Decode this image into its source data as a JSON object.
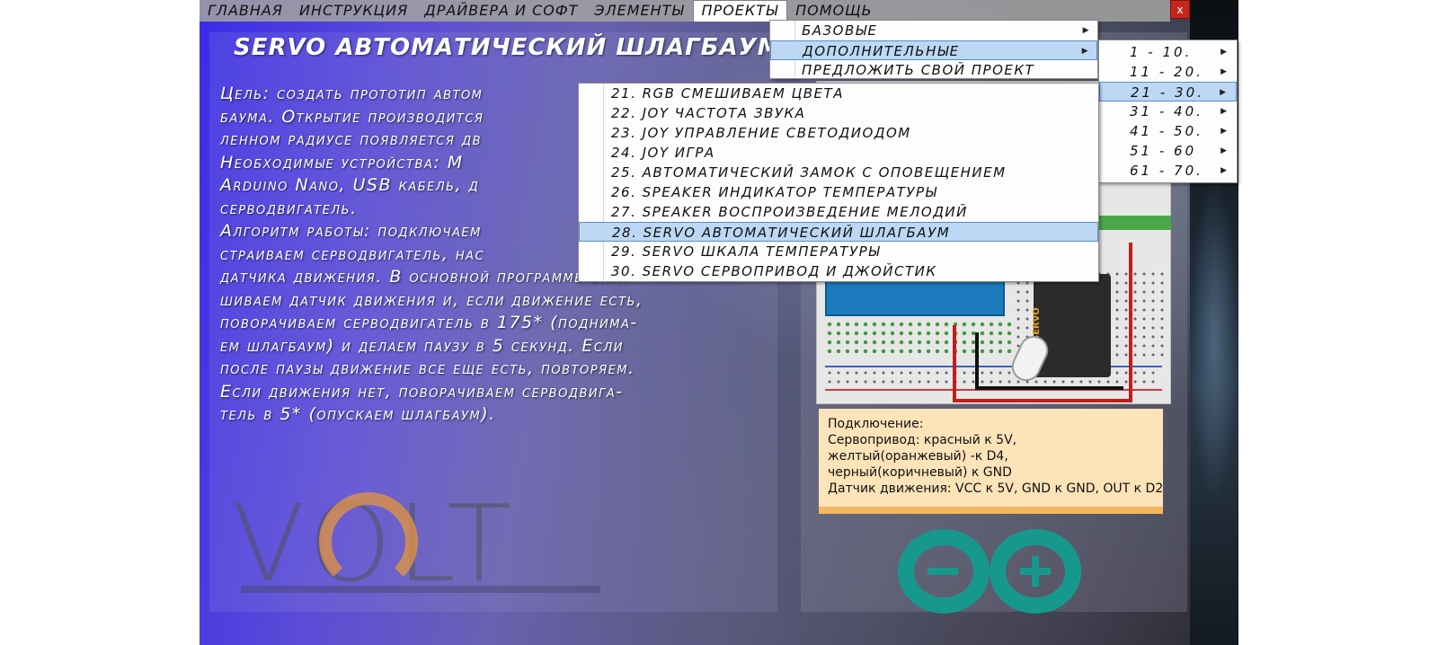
{
  "window": {
    "close_label": "x"
  },
  "menubar": {
    "items": [
      {
        "label": "ГЛАВНАЯ"
      },
      {
        "label": "ИНСТРУКЦИЯ"
      },
      {
        "label": "ДРАЙВЕРА И СОФТ"
      },
      {
        "label": "ЭЛЕМЕНТЫ"
      },
      {
        "label": "ПРОЕКТЫ"
      },
      {
        "label": "ПОМОЩЬ"
      }
    ],
    "open_item": "ПРОЕКТЫ"
  },
  "page": {
    "title": "SERVO АВТОМАТИЧЕСКИЙ ШЛАГБАУМ",
    "text_lines": [
      "Цель: создать прототип автом",
      "баума. Открытие производится",
      "ленном радиусе появляется дв",
      "Необходимые устройства: М",
      "Arduino Nano, USB кабель, д",
      "серводвигатель.",
      "Алгоритм работы: подключаем",
      "страиваем серводвигатель, нас",
      "датчика движения. В основной программе опра-",
      "шиваем датчик движения и, если движение есть,",
      "поворачиваем серводвигатель в 175* (поднима-",
      "ем шлагбаум) и делаем паузу в 5 секунд. Если",
      "после паузы движение все еще есть, повторяем.",
      "Если движения нет, поворачиваем серводвига-",
      "тель в 5* (опускаем шлагбаум)."
    ]
  },
  "logo": {
    "text": "VOLT"
  },
  "diagram": {
    "servo_label": "SERVO"
  },
  "connection_note": {
    "lines": [
      "Подключение:",
      "Сервопривод: красный к 5V,",
      "желтый(оранжевый) -к D4,",
      "черный(коричневый) к GND",
      "Датчик движения: VCC к 5V, GND к GND, OUT к D2"
    ]
  },
  "projects_menu": {
    "items": [
      {
        "label": "БАЗОВЫЕ",
        "submenu": true
      },
      {
        "label": "ДОПОЛНИТЕЛЬНЫЕ",
        "submenu": true,
        "highlighted": true
      },
      {
        "label": "ПРЕДЛОЖИТЬ СВОЙ ПРОЕКТ",
        "submenu": false
      }
    ]
  },
  "ranges_menu": {
    "items": [
      {
        "label": "1 - 10."
      },
      {
        "label": "11 - 20."
      },
      {
        "label": "21 - 30.",
        "highlighted": true
      },
      {
        "label": "31 - 40."
      },
      {
        "label": "41 - 50."
      },
      {
        "label": "51 - 60"
      },
      {
        "label": "61 - 70."
      }
    ]
  },
  "projects_submenu": {
    "items": [
      {
        "label": "21. RGB СМЕШИВАЕМ ЦВЕТА"
      },
      {
        "label": "22. JOY ЧАСТОТА ЗВУКА"
      },
      {
        "label": "23. JOY УПРАВЛЕНИЕ СВЕТОДИОДОМ"
      },
      {
        "label": "24. JOY ИГРА"
      },
      {
        "label": "25. АВТОМАТИЧЕСКИЙ ЗАМОК С ОПОВЕЩЕНИЕМ"
      },
      {
        "label": "26. SPEAKER ИНДИКАТОР ТЕМПЕРАТУРЫ"
      },
      {
        "label": "27. SPEAKER ВОСПРОИЗВЕДЕНИЕ МЕЛОДИЙ"
      },
      {
        "label": "28. SERVO АВТОМАТИЧЕСКИЙ ШЛАГБАУМ",
        "highlighted": true
      },
      {
        "label": "29. SERVO ШКАЛА ТЕМПЕРАТУРЫ"
      },
      {
        "label": "30. SERVO СЕРВОПРИВОД И ДЖОЙСТИК"
      }
    ]
  },
  "colors": {
    "menu_highlight": "#bcd8f4",
    "close_button": "#c8261c",
    "arduino_teal": "#16998c"
  }
}
